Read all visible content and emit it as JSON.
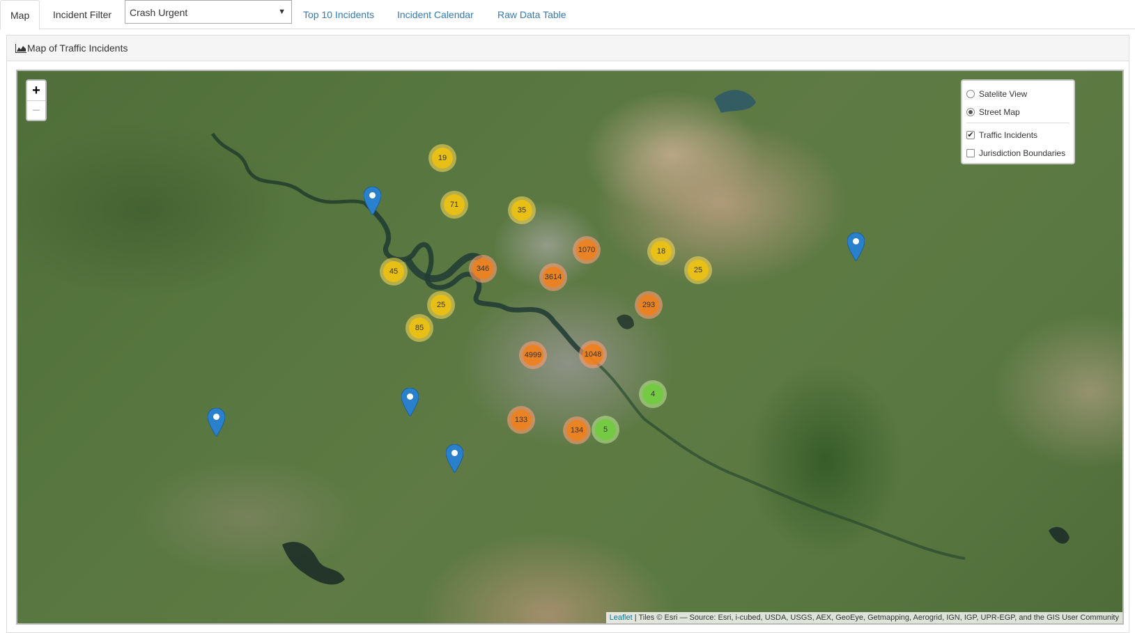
{
  "nav": {
    "tab_map": "Map",
    "tab_incident_filter": "Incident Filter",
    "filter_select_value": "Crash Urgent",
    "link_top10": "Top 10 Incidents",
    "link_calendar": "Incident Calendar",
    "link_raw_data": "Raw Data Table"
  },
  "panel": {
    "title": "Map of Traffic Incidents",
    "title_icon": "area-chart-icon"
  },
  "map": {
    "zoom_in_label": "+",
    "zoom_out_label": "−",
    "layers": {
      "base_layers": [
        {
          "label": "Satelite View",
          "selected": false
        },
        {
          "label": "Street Map",
          "selected": true
        }
      ],
      "overlays": [
        {
          "label": "Traffic Incidents",
          "checked": true
        },
        {
          "label": "Jurisdiction Boundaries",
          "checked": false
        }
      ]
    },
    "clusters": [
      "19",
      "71",
      "35",
      "45",
      "346",
      "1070",
      "3614",
      "18",
      "25",
      "25",
      "293",
      "85",
      "4999",
      "1048",
      "4",
      "133",
      "134",
      "5"
    ],
    "cluster_colors": {
      "small": "#6ecc39",
      "medium": "#f0c20c",
      "large": "#f18017"
    },
    "marker_color": "#2a81cb",
    "attribution": {
      "leaflet_link": "Leaflet",
      "text": " | Tiles © Esri — Source: Esri, i-cubed, USDA, USGS, AEX, GeoEye, Getmapping, Aerogrid, IGN, IGP, UPR-EGP, and the GIS User Community"
    }
  }
}
